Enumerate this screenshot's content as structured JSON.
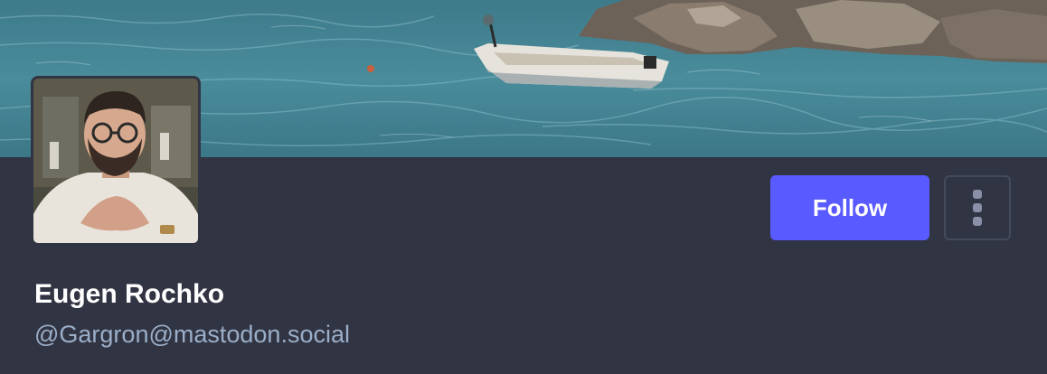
{
  "profile": {
    "display_name": "Eugen Rochko",
    "handle": "@Gargron@mastodon.social"
  },
  "actions": {
    "follow_label": "Follow",
    "menu_icon": "vertical-ellipsis-icon"
  },
  "colors": {
    "background": "#313543",
    "accent": "#595aff",
    "handle_text": "#9baec8",
    "name_text": "#ffffff"
  }
}
